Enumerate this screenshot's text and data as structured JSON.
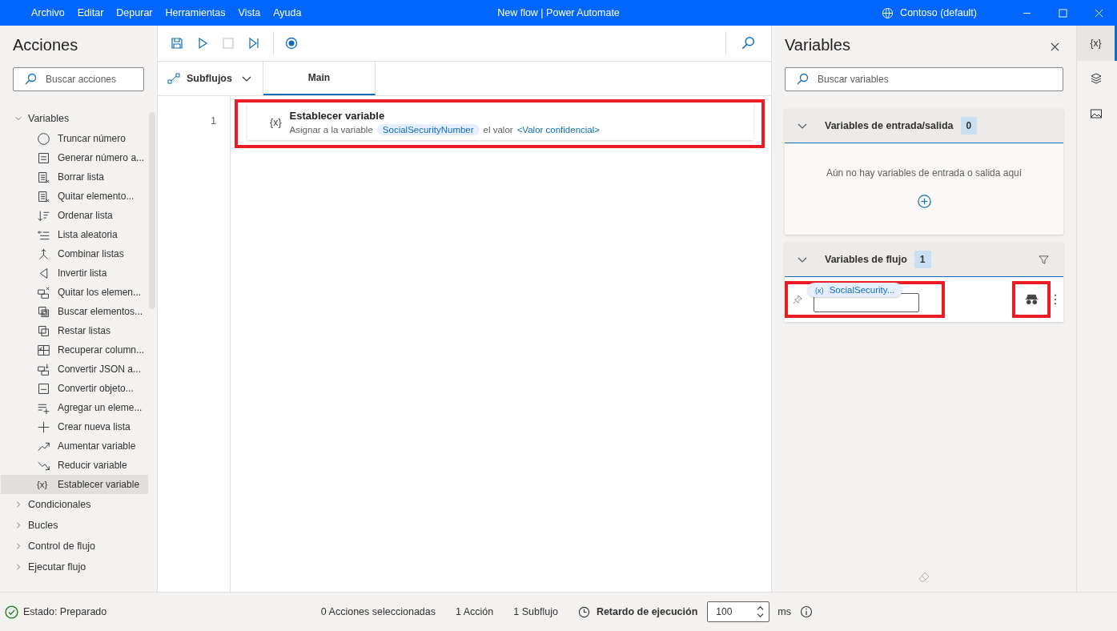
{
  "window": {
    "title": "New flow | Power Automate",
    "account": "Contoso (default)"
  },
  "menu": [
    "Archivo",
    "Editar",
    "Depurar",
    "Herramientas",
    "Vista",
    "Ayuda"
  ],
  "actions_pane": {
    "title": "Acciones",
    "search": {
      "placeholder": "Buscar acciones"
    },
    "tree": [
      {
        "label": "Variables",
        "expanded": true,
        "children": [
          {
            "label": "Truncar número",
            "selected": false
          },
          {
            "label": "Generar número a...",
            "selected": false
          },
          {
            "label": "Borrar lista",
            "selected": false
          },
          {
            "label": "Quitar elemento...",
            "selected": false
          },
          {
            "label": "Ordenar lista",
            "selected": false
          },
          {
            "label": "Lista aleatoria",
            "selected": false
          },
          {
            "label": "Combinar listas",
            "selected": false
          },
          {
            "label": "Invertir lista",
            "selected": false
          },
          {
            "label": "Quitar los elemen...",
            "selected": false
          },
          {
            "label": "Buscar elementos...",
            "selected": false
          },
          {
            "label": "Restar listas",
            "selected": false
          },
          {
            "label": "Recuperar column...",
            "selected": false
          },
          {
            "label": "Convertir JSON a...",
            "selected": false
          },
          {
            "label": "Convertir objeto...",
            "selected": false
          },
          {
            "label": "Agregar un eleme...",
            "selected": false
          },
          {
            "label": "Crear nueva lista",
            "selected": false
          },
          {
            "label": "Aumentar variable",
            "selected": false
          },
          {
            "label": "Reducir variable",
            "selected": false
          },
          {
            "label": "Establecer variable",
            "selected": true,
            "icon_text": "{x}"
          }
        ]
      },
      {
        "label": "Condicionales",
        "expanded": false
      },
      {
        "label": "Bucles",
        "expanded": false
      },
      {
        "label": "Control de flujo",
        "expanded": false
      },
      {
        "label": "Ejecutar flujo",
        "expanded": false
      }
    ]
  },
  "tabs": {
    "subflows_label": "Subflujos",
    "items": [
      {
        "label": "Main",
        "selected": true
      }
    ]
  },
  "flow": {
    "steps": [
      {
        "number": "1",
        "icon_text": "{x}",
        "title": "Establecer variable",
        "text_before": "Asignar a la variable",
        "variable": "SocialSecurityNumber",
        "text_middle": "el valor",
        "value": "<Valor confidencial>",
        "highlighted": true
      }
    ]
  },
  "variables_pane": {
    "title": "Variables",
    "search": {
      "placeholder": "Buscar variables"
    },
    "sections": [
      {
        "title": "Variables de entrada/salida",
        "count": "0",
        "expanded": true,
        "empty_text": "Aún no hay variables de entrada o salida aquí"
      },
      {
        "title": "Variables de flujo",
        "count": "1",
        "expanded": true,
        "variables": [
          {
            "icon_text": "(x)",
            "name": "SocialSecurity...",
            "pinned": false,
            "sensitive": true,
            "highlighted": true,
            "sensitive_highlighted": true
          }
        ]
      }
    ]
  },
  "rail": [
    {
      "kind": "variables",
      "label": "{x}",
      "selected": true
    },
    {
      "kind": "layers",
      "selected": false
    },
    {
      "kind": "images",
      "selected": false
    }
  ],
  "status_bar": {
    "status": "Estado: Preparado",
    "selected_actions": "0 Acciones seleccionadas",
    "actions": "1 Acción",
    "subflows": "1 Subflujo",
    "delay_label": "Retardo de ejecución",
    "delay_value": "100",
    "delay_unit": "ms"
  }
}
